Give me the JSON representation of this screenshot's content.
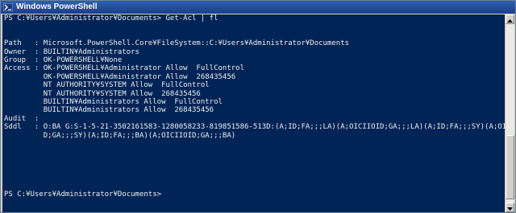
{
  "window": {
    "title": "Windows PowerShell"
  },
  "console": {
    "lines": [
      "PS C:¥Users¥Administrator¥Documents> Get-Acl | fl",
      "",
      "",
      "Path   : Microsoft.PowerShell.Core¥FileSystem::C:¥Users¥Administrator¥Documents",
      "Owner  : BUILTIN¥Administrators",
      "Group  : OK-POWERSHELL¥None",
      "Access : OK-POWERSHELL¥Administrator Allow  FullControl",
      "         OK-POWERSHELL¥Administrator Allow  268435456",
      "         NT AUTHORITY¥SYSTEM Allow  FullControl",
      "         NT AUTHORITY¥SYSTEM Allow  268435456",
      "         BUILTIN¥Administrators Allow  FullControl",
      "         BUILTIN¥Administrators Allow  268435456",
      "Audit  :",
      "Sddl   : O:BA G:S-1-5-21-3502161583-1280058233-819851586-513D:(A;ID;FA;;;LA)(A;OICIIOID;GA;;;LA)(A;ID;FA;;;SY)(A;OICIIOI",
      "         D;GA;;;SY)(A;ID;FA;;;BA)(A;OICIIOID;GA;;;BA)",
      "",
      "",
      "",
      "",
      "",
      "",
      "PS C:¥Users¥Administrator¥Documents>"
    ]
  },
  "icons": {
    "app": "powershell-icon",
    "scroll_up": "arrow-up-icon",
    "scroll_down": "arrow-down-icon"
  },
  "colors": {
    "titlebar": "#1b3f8a",
    "console_background": "#012456",
    "console_text": "#eeedf0"
  }
}
